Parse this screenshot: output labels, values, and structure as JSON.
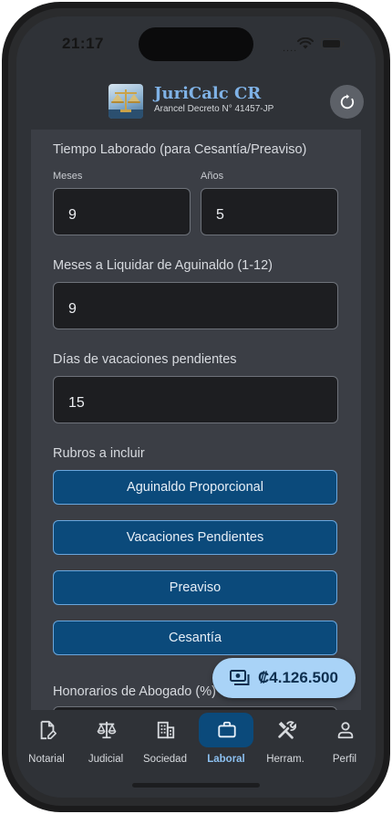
{
  "status_bar": {
    "time": "21:17",
    "signal": "....",
    "icons": [
      "wifi-icon",
      "battery-icon"
    ]
  },
  "header": {
    "title": "JuriCalc CR",
    "subtitle": "Arancel Decreto N° 41457-JP",
    "logo_icon": "scales-of-justice-logo",
    "refresh_icon": "refresh-icon"
  },
  "form": {
    "tiempo_laborado": {
      "label": "Tiempo Laborado (para Cesantía/Preaviso)",
      "meses_label": "Meses",
      "meses_value": "9",
      "anios_label": "Años",
      "anios_value": "5"
    },
    "aguinaldo": {
      "label": "Meses a Liquidar de Aguinaldo (1-12)",
      "value": "9"
    },
    "vacaciones": {
      "label": "Días de vacaciones pendientes",
      "value": "15"
    },
    "rubros": {
      "label": "Rubros a incluir",
      "items": [
        "Aguinaldo Proporcional",
        "Vacaciones Pendientes",
        "Preaviso",
        "Cesantía"
      ]
    },
    "honorarios": {
      "label": "Honorarios de Abogado (%)"
    }
  },
  "fab": {
    "total": "₡4.126.500",
    "icon": "money-icon"
  },
  "bottom_nav": {
    "active": "Laboral",
    "items": [
      {
        "label": "Notarial",
        "icon": "document-edit-icon"
      },
      {
        "label": "Judicial",
        "icon": "scales-icon"
      },
      {
        "label": "Sociedad",
        "icon": "building-icon"
      },
      {
        "label": "Laboral",
        "icon": "briefcase-icon"
      },
      {
        "label": "Herram.",
        "icon": "tools-icon"
      },
      {
        "label": "Perfil",
        "icon": "user-icon"
      }
    ]
  },
  "colors": {
    "accent": "#0b4a7b",
    "accent_border": "#6aa6dc",
    "brand": "#7fb2e6",
    "fab_bg": "#a9d3f7",
    "surface": "#3b3e45",
    "input_bg": "#1d1e21"
  }
}
